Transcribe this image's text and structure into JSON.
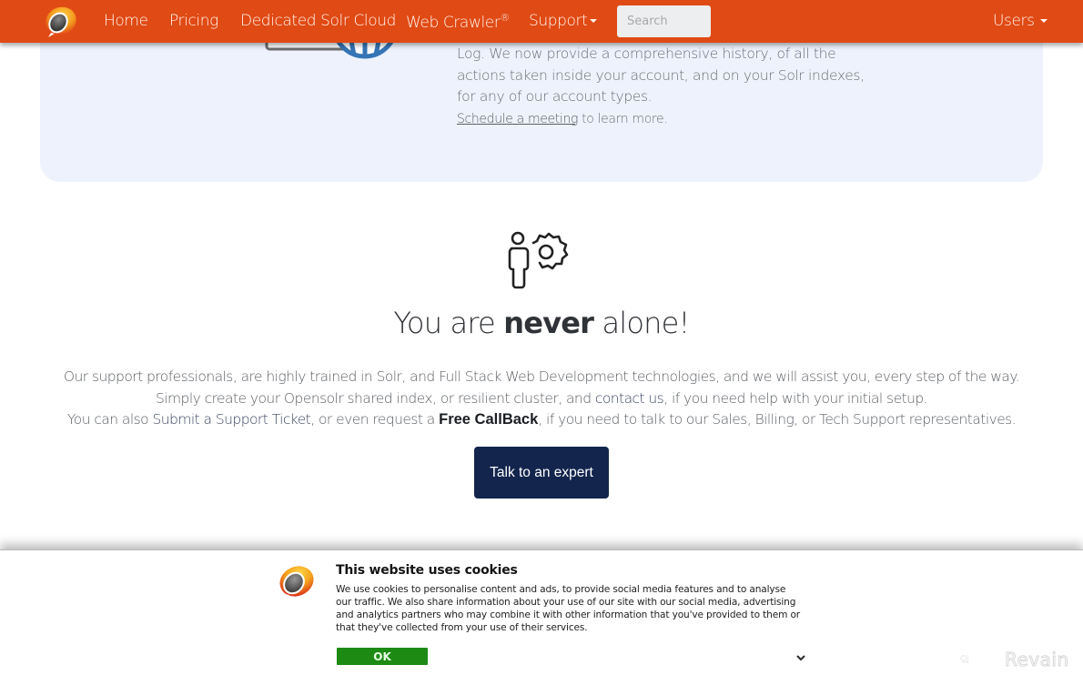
{
  "nav": {
    "items": [
      {
        "label": "Home"
      },
      {
        "label": "Pricing"
      },
      {
        "label": "Dedicated Solr Cloud"
      },
      {
        "label": "Web Crawler",
        "sup": "®"
      },
      {
        "label": "Support",
        "dropdown": true
      }
    ],
    "search_placeholder": "Search",
    "users_label": "Users",
    "brand_color": "#e04a14",
    "logo_icon": "opensolr-logo-icon"
  },
  "top_card": {
    "illustration_icon": "activity-log-globe-icon",
    "lines": [
      "Log. We now provide a comprehensive history, of all the",
      "actions taken inside your account, and on your Solr indexes,",
      "for any of our account types."
    ],
    "link_label": "Schedule a meeting",
    "link_suffix": " to learn more.",
    "background": "#edf2fd"
  },
  "support": {
    "icon": "person-gear-icon",
    "headline_pre": "You are ",
    "headline_bold": "never",
    "headline_post": " alone!",
    "line1": "Our support professionals, are highly trained in Solr, and Full Stack Web Development technologies, and we will assist you, every step of the way.",
    "line2_pre": "Simply create your Opensolr shared index, or resilient cluster, and ",
    "line2_link": "contact us",
    "line2_post": ", if you need help with your initial setup.",
    "line3_pre": "You can also ",
    "line3_link": "Submit a Support Ticket",
    "line3_mid": ", or even request a ",
    "line3_bold_link": "Free CallBack",
    "line3_post": ", if you need to talk to our Sales, Billing, or Tech Support representatives.",
    "cta_label": "Talk to an expert",
    "cta_color": "#13254d"
  },
  "cookie_banner": {
    "title": "This website uses cookies",
    "lines": [
      "We use cookies to personalise content and ads, to provide social media features and to analyse",
      "our traffic. We also share information about your use of our site with our social media, advertising",
      "and analytics partners who may combine it with other information that you've provided to them or",
      "that they've collected from your use of their services."
    ],
    "ok_label": "OK",
    "ok_color": "#1d8a14",
    "details_icon": "chevron-down-icon"
  },
  "watermark": {
    "label": "Revain"
  }
}
